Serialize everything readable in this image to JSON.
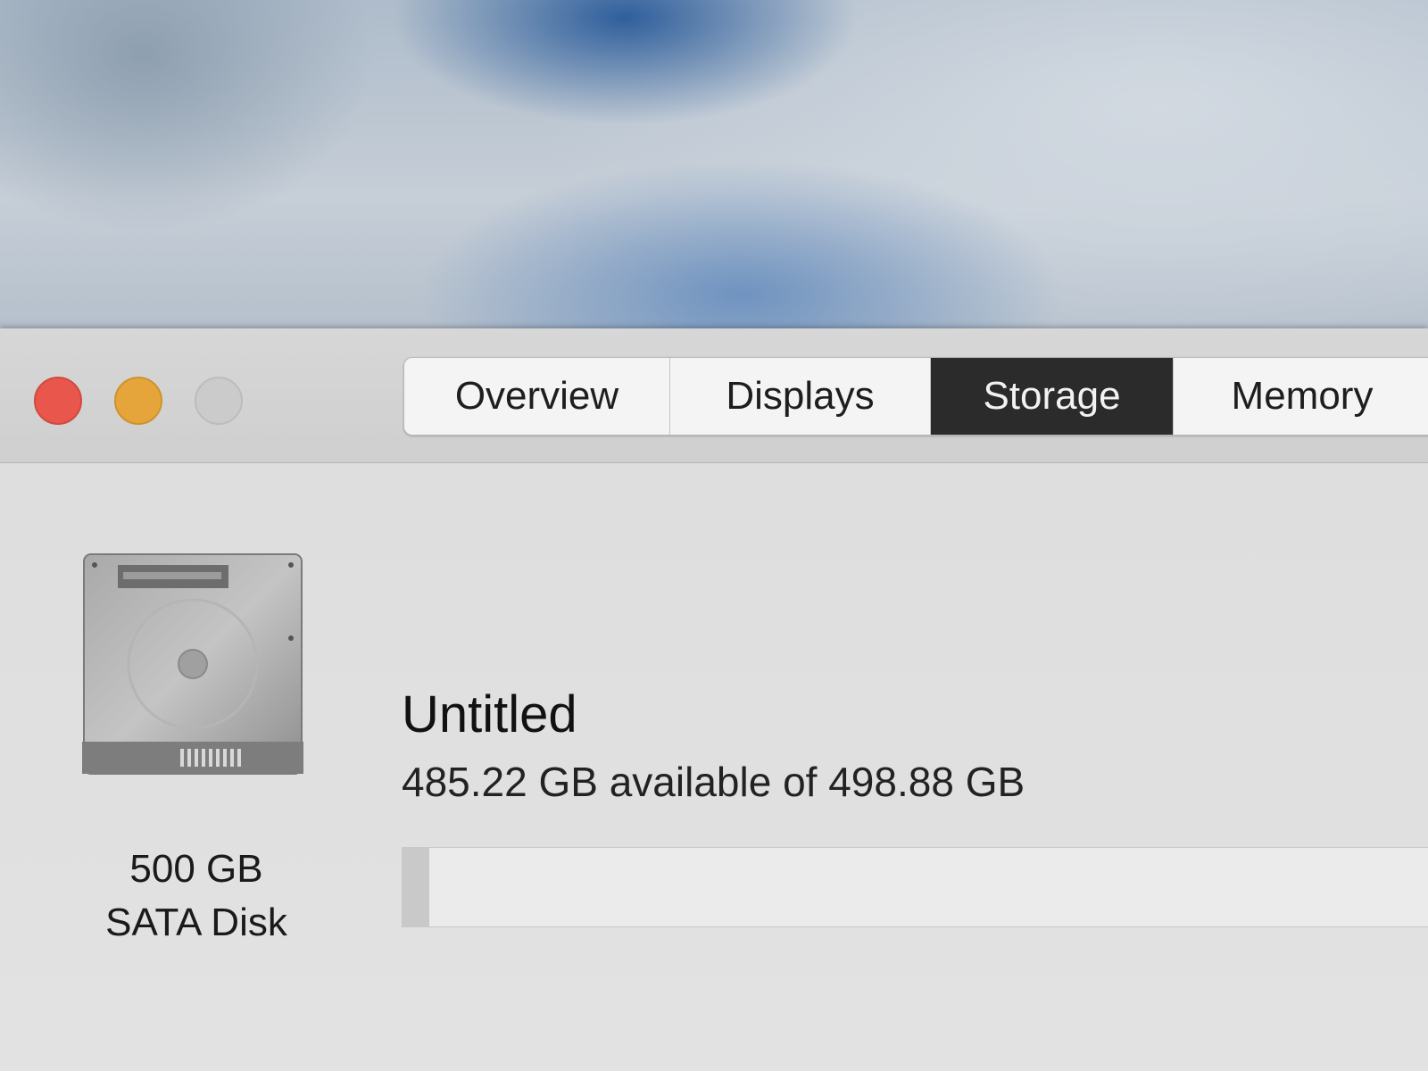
{
  "tabs": [
    {
      "label": "Overview",
      "selected": false
    },
    {
      "label": "Displays",
      "selected": false
    },
    {
      "label": "Storage",
      "selected": true
    },
    {
      "label": "Memory",
      "selected": false
    }
  ],
  "disk": {
    "icon": "hard-disk-icon",
    "size_label": "500 GB",
    "type_label": "SATA Disk"
  },
  "volume": {
    "name": "Untitled",
    "space_text": "485.22 GB available of 498.88 GB",
    "used_fraction": 0.027
  },
  "colors": {
    "close": "#e9574c",
    "minimize": "#e6a53a",
    "zoom": "#cbcbcb",
    "selected_tab": "#2b2b2b"
  }
}
